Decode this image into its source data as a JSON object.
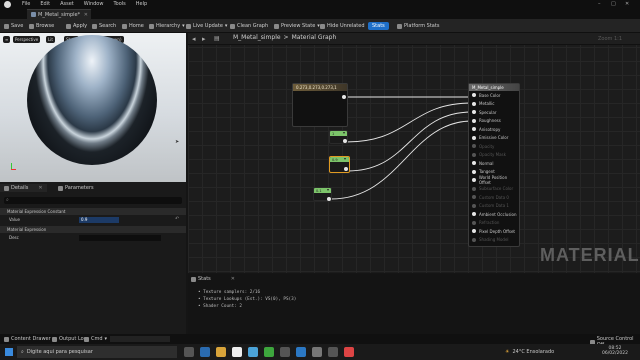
{
  "menu": {
    "items": [
      "File",
      "Edit",
      "Asset",
      "Window",
      "Tools",
      "Help"
    ]
  },
  "tab": {
    "title": "M_Metal_simple*"
  },
  "toolbar": {
    "save": "Save",
    "browse": "Browse",
    "apply": "Apply",
    "search": "Search",
    "home": "Home",
    "hierarchy": "Hierarchy",
    "live_update": "Live Update",
    "clean_graph": "Clean Graph",
    "preview_state": "Preview State",
    "hide_unrelated": "Hide Unrelated",
    "stats": "Stats",
    "platform_stats": "Platform Stats"
  },
  "viewport": {
    "perspective": "Perspective",
    "lit": "Lit",
    "show": "Show",
    "sky": "Cloud Sky (Shown)"
  },
  "details": {
    "tab_details": "Details",
    "tab_parameters": "Parameters",
    "section_constant": "Material Expression Constant",
    "value_label": "Value",
    "value": "0.9",
    "section_expression": "Material Expression",
    "desc_label": "Desc"
  },
  "graph": {
    "breadcrumb_asset": "M_Metal_simple",
    "breadcrumb_sep": ">",
    "breadcrumb_graph": "Material Graph",
    "zoom": "Zoom 1:1",
    "watermark": "MATERIAL"
  },
  "nodes": {
    "vector": "0.273,0.273,0.273,1",
    "c1": "1",
    "c2": "0.9",
    "c3": "0.1"
  },
  "material_node": {
    "title": "M_Metal_simple",
    "pins": [
      {
        "label": "Base Color",
        "on": true
      },
      {
        "label": "Metallic",
        "on": true
      },
      {
        "label": "Specular",
        "on": true
      },
      {
        "label": "Roughness",
        "on": true
      },
      {
        "label": "Anisotropy",
        "on": true
      },
      {
        "label": "Emissive Color",
        "on": true
      },
      {
        "label": "Opacity",
        "on": false
      },
      {
        "label": "Opacity Mask",
        "on": false
      },
      {
        "label": "Normal",
        "on": true
      },
      {
        "label": "Tangent",
        "on": true
      },
      {
        "label": "World Position Offset",
        "on": true
      },
      {
        "label": "Subsurface Color",
        "on": false
      },
      {
        "label": "Custom Data 0",
        "on": false
      },
      {
        "label": "Custom Data 1",
        "on": false
      },
      {
        "label": "Ambient Occlusion",
        "on": true
      },
      {
        "label": "Refraction",
        "on": false
      },
      {
        "label": "Pixel Depth Offset",
        "on": true
      },
      {
        "label": "Shading Model",
        "on": false
      }
    ]
  },
  "stats": {
    "tab": "Stats",
    "lines": [
      "• Texture samplers: 2/16",
      "• Texture Lookups (Est.): VS(0), PS(3)",
      "• Shader Count: 2"
    ]
  },
  "statusbar": {
    "content_drawer": "Content Drawer",
    "output_log": "Output Log",
    "cmd": "Cmd",
    "source_control": "Source Control Off"
  },
  "taskbar": {
    "search_placeholder": "Digite aqui para pesquisar",
    "weather": "24°C  Ensolarado",
    "time": "08:52",
    "date": "06/02/2022"
  }
}
